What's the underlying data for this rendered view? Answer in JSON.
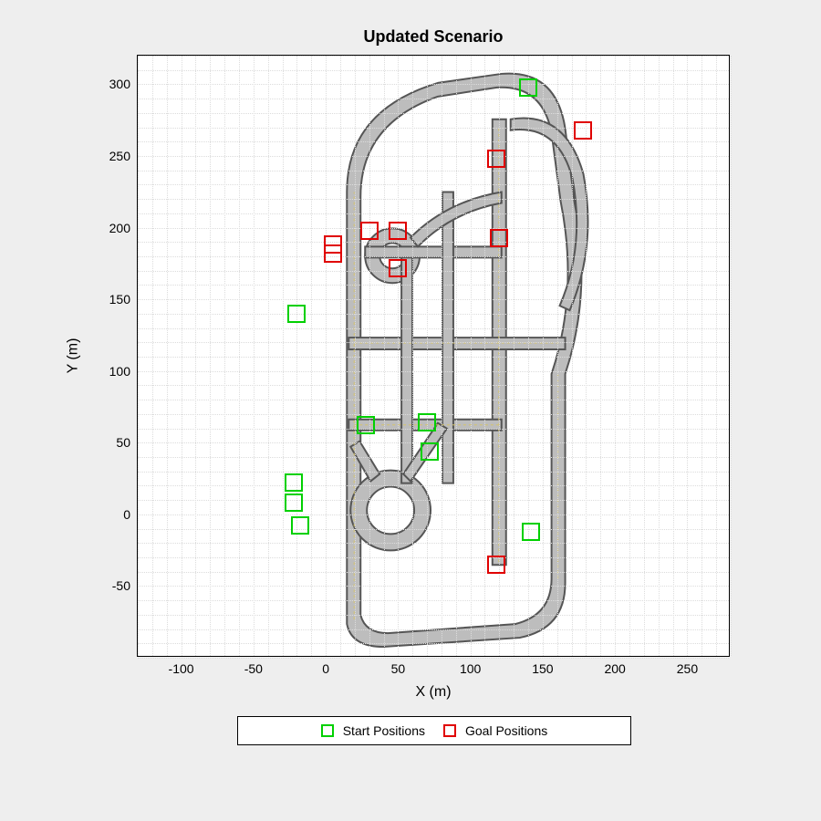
{
  "chart_data": {
    "type": "scatter",
    "title": "Updated Scenario",
    "xlabel": "X (m)",
    "ylabel": "Y (m)",
    "xlim": [
      -130,
      280
    ],
    "ylim": [
      -100,
      320
    ],
    "xticks": [
      -100,
      -50,
      0,
      50,
      100,
      150,
      200,
      250
    ],
    "yticks": [
      -50,
      0,
      50,
      100,
      150,
      200,
      250,
      300
    ],
    "grid_minor_step": 10,
    "series": [
      {
        "name": "Start Positions",
        "color": "#00d000",
        "points": [
          {
            "x": 140,
            "y": 298
          },
          {
            "x": -20,
            "y": 140
          },
          {
            "x": 28,
            "y": 62
          },
          {
            "x": 70,
            "y": 64
          },
          {
            "x": 72,
            "y": 44
          },
          {
            "x": -22,
            "y": 22
          },
          {
            "x": -22,
            "y": 8
          },
          {
            "x": -18,
            "y": -8
          },
          {
            "x": 142,
            "y": -12
          }
        ]
      },
      {
        "name": "Goal Positions",
        "color": "#e00000",
        "points": [
          {
            "x": 178,
            "y": 268
          },
          {
            "x": 118,
            "y": 248
          },
          {
            "x": 30,
            "y": 198
          },
          {
            "x": 50,
            "y": 198
          },
          {
            "x": 120,
            "y": 193
          },
          {
            "x": 5,
            "y": 188
          },
          {
            "x": 5,
            "y": 182
          },
          {
            "x": 50,
            "y": 172
          },
          {
            "x": 118,
            "y": -35
          }
        ]
      }
    ],
    "legend": {
      "position": "south-outside",
      "entries": [
        "Start Positions",
        "Goal Positions"
      ]
    }
  },
  "title": "Updated Scenario",
  "xlabel": "X (m)",
  "ylabel": "Y (m)",
  "legend_start": "Start Positions",
  "legend_goal": "Goal Positions"
}
